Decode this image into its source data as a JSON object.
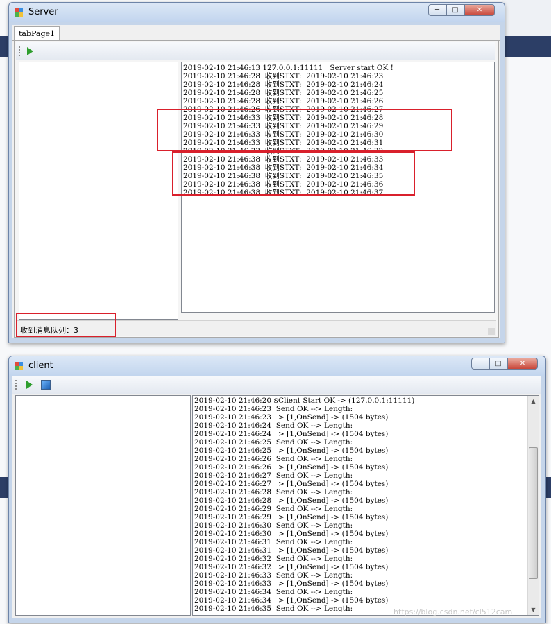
{
  "server_window": {
    "title": "Server",
    "tab_label": "tabPage1",
    "status_text": "收到消息队列：3",
    "log_lines": [
      "2019-02-10 21:46:13 127.0.0.1:11111   Server start OK !",
      "2019-02-10 21:46:28  收到STXT:  2019-02-10 21:46:23",
      "2019-02-10 21:46:28  收到STXT:  2019-02-10 21:46:24",
      "2019-02-10 21:46:28  收到STXT:  2019-02-10 21:46:25",
      "2019-02-10 21:46:28  收到STXT:  2019-02-10 21:46:26",
      "2019-02-10 21:46:26  收到STXT:  2019-02-10 21:46:27",
      "2019-02-10 21:46:33  收到STXT:  2019-02-10 21:46:28",
      "2019-02-10 21:46:33  收到STXT:  2019-02-10 21:46:29",
      "2019-02-10 21:46:33  收到STXT:  2019-02-10 21:46:30",
      "2019-02-10 21:46:33  收到STXT:  2019-02-10 21:46:31",
      "2019-02-10 21:46:33  收到STXT:  2019-02-10 21:46:32",
      "2019-02-10 21:46:38  收到STXT:  2019-02-10 21:46:33",
      "2019-02-10 21:46:38  收到STXT:  2019-02-10 21:46:34",
      "2019-02-10 21:46:38  收到STXT:  2019-02-10 21:46:35",
      "2019-02-10 21:46:38  收到STXT:  2019-02-10 21:46:36",
      "2019-02-10 21:46:38  收到STXT:  2019-02-10 21:46:37"
    ]
  },
  "client_window": {
    "title": "client",
    "scroll_position": 0.62,
    "log_lines": [
      "2019-02-10 21:46:20 $Client Start OK -> (127.0.0.1:11111)",
      "2019-02-10 21:46:23  Send OK --> Length:",
      "2019-02-10 21:46:23   > [1,OnSend] -> (1504 bytes)",
      "2019-02-10 21:46:24  Send OK --> Length:",
      "2019-02-10 21:46:24   > [1,OnSend] -> (1504 bytes)",
      "2019-02-10 21:46:25  Send OK --> Length:",
      "2019-02-10 21:46:25   > [1,OnSend] -> (1504 bytes)",
      "2019-02-10 21:46:26  Send OK --> Length:",
      "2019-02-10 21:46:26   > [1,OnSend] -> (1504 bytes)",
      "2019-02-10 21:46:27  Send OK --> Length:",
      "2019-02-10 21:46:27   > [1,OnSend] -> (1504 bytes)",
      "2019-02-10 21:46:28  Send OK --> Length:",
      "2019-02-10 21:46:28   > [1,OnSend] -> (1504 bytes)",
      "2019-02-10 21:46:29  Send OK --> Length:",
      "2019-02-10 21:46:29   > [1,OnSend] -> (1504 bytes)",
      "2019-02-10 21:46:30  Send OK --> Length:",
      "2019-02-10 21:46:30   > [1,OnSend] -> (1504 bytes)",
      "2019-02-10 21:46:31  Send OK --> Length:",
      "2019-02-10 21:46:31   > [1,OnSend] -> (1504 bytes)",
      "2019-02-10 21:46:32  Send OK --> Length:",
      "2019-02-10 21:46:32   > [1,OnSend] -> (1504 bytes)",
      "2019-02-10 21:46:33  Send OK --> Length:",
      "2019-02-10 21:46:33   > [1,OnSend] -> (1504 bytes)",
      "2019-02-10 21:46:34  Send OK --> Length:",
      "2019-02-10 21:46:34   > [1,OnSend] -> (1504 bytes)",
      "2019-02-10 21:46:35  Send OK --> Length:"
    ]
  },
  "background": {
    "watermark": "https://blog.csdn.net/cl512cam"
  },
  "icons": {
    "app_icon": "winforms-app-icon",
    "play": "play-icon",
    "image": "image-icon"
  },
  "colors": {
    "highlight_box": "#d9202c",
    "play_green": "#2e9e2e"
  }
}
